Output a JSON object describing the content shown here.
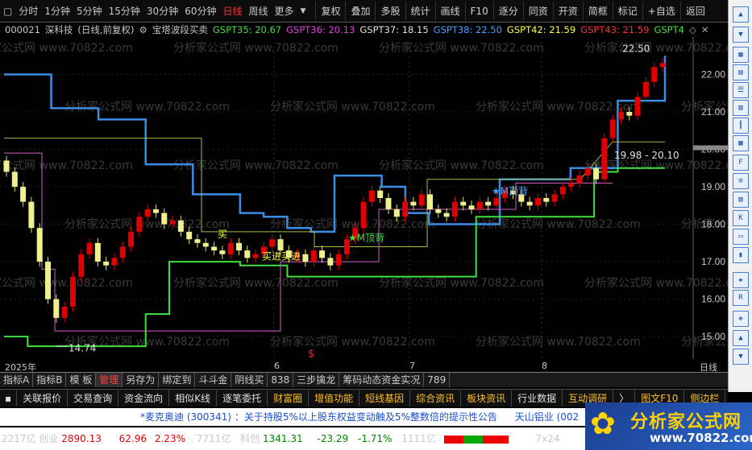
{
  "periods": [
    "分时",
    "1分钟",
    "5分钟",
    "15分钟",
    "30分钟",
    "60分钟",
    "日线",
    "周线",
    "更多"
  ],
  "active_period": "日线",
  "toolbar": [
    "复权",
    "叠加",
    "多股",
    "统计",
    "画线",
    "F10",
    "逐分",
    "同资",
    "开资",
    "简框",
    "标记",
    "+自选",
    "返回"
  ],
  "stock": {
    "code": "000021",
    "name": "深科技",
    "mode": "(日线,前复权)"
  },
  "indicator": {
    "name": "宝塔波段买卖",
    "params": [
      {
        "label": "GSPT35: 20.67",
        "color": "#40e040"
      },
      {
        "label": "GSPT36: 20.13",
        "color": "#e040e0"
      },
      {
        "label": "GSPT37: 18.15",
        "color": "#e0e0e0"
      },
      {
        "label": "GSPT38: 22.50",
        "color": "#40a0ff"
      },
      {
        "label": "GSPT42: 21.59",
        "color": "#ffff40"
      },
      {
        "label": "GSPT43: 21.59",
        "color": "#ff3030"
      },
      {
        "label": "GSPT4",
        "color": "#40e040"
      }
    ]
  },
  "price_axis": [
    "22.00",
    "21.00",
    "20.00",
    "19.00",
    "18.00",
    "17.00",
    "16.00",
    "15.00"
  ],
  "annotations": {
    "high": "22.50",
    "low": "14.74",
    "crosshair_price": "19.98 - 20.10",
    "buy1": "买",
    "buy2": "买进买进",
    "signal": "★M顶背",
    "signal2": "★M顶背",
    "marker": "$"
  },
  "time_axis": {
    "year": "2025年",
    "m6": "6",
    "m7": "7",
    "m8": "8",
    "period": "日线"
  },
  "tabs1": [
    "指标A",
    "指标B",
    "模 板",
    "管理",
    "另存为",
    "绑定到",
    "斗斗金",
    "阴线买",
    "838",
    "三步擒龙",
    "筹码动态资金实况",
    "789"
  ],
  "tabs1_active": "管理",
  "tabs2": [
    "关联报价",
    "交易查询",
    "资金流向",
    "相似K线",
    "逐笔委托",
    "财富圈",
    "增值功能",
    "短线基因",
    "综合资讯",
    "板块资讯",
    "行业数据",
    "互动调研",
    "〉",
    "图文F10",
    "侧边栏"
  ],
  "ticker": {
    "name": "*麦克奥迪",
    "code": "(300341)",
    "text": "：关于持股5%以上股东权益变动触及5%整数倍的提示性公告",
    "next": "天山铝业",
    "next_code": "(002"
  },
  "status": {
    "vol1": "2217亿",
    "idx1_name": "创业",
    "idx1_val": "2890.13",
    "idx1_chg": "62.96",
    "idx1_pct": "2.23%",
    "idx1_amt": "7711亿",
    "idx2_name": "科创",
    "idx2_val": "1341.31",
    "idx2_chg": "-23.29",
    "idx2_pct": "-1.71%",
    "idx2_amt": "1111亿",
    "extra": "7x24"
  },
  "watermark": "分析家公式网 www.70822.com",
  "brand": {
    "name": "分析家公式网",
    "url": "www.70822.com"
  },
  "right_icons": [
    "MACD",
    "KDJ",
    "RSI",
    "BOLL",
    "DMI",
    "CCI",
    "WR",
    "VOL",
    "OBV",
    "SAR",
    "MA",
    "EXP",
    "BIAS",
    "ROC",
    "TRIX",
    "ASI",
    "PSY",
    "BRAR",
    "CR",
    "VR",
    "DMA"
  ],
  "colors": {
    "blue_line": "#3a8ee6",
    "green_line": "#40e040",
    "olive_line": "#a0c040",
    "magenta_line": "#d060d0",
    "up": "#e00000",
    "down": "#e0e060"
  },
  "chart_data": {
    "type": "candlestick",
    "price_range": [
      14.4,
      23.0
    ],
    "grid": true,
    "series": [
      {
        "name": "GSPT38",
        "values": [
          22.0,
          22.0,
          21.1,
          21.1,
          20.8,
          20.8,
          19.6,
          19.6,
          18.8,
          18.8,
          18.3,
          18.2,
          17.9,
          17.8,
          19.3,
          19.3,
          19.0,
          18.3,
          18.0,
          18.0,
          18.0,
          19.2,
          19.2,
          19.2,
          19.5,
          19.5,
          21.3,
          21.3,
          22.5
        ]
      },
      {
        "name": "GSPT37",
        "values": [
          15.0,
          14.74,
          14.74,
          14.74,
          14.74,
          14.74,
          15.6,
          17.0,
          17.0,
          17.0,
          16.9,
          16.9,
          16.6,
          16.6,
          16.6,
          16.6,
          16.6,
          16.6,
          16.6,
          16.6,
          18.2,
          18.2,
          18.2,
          18.2,
          18.2,
          19.4,
          19.5,
          19.5,
          19.5
        ]
      }
    ]
  }
}
